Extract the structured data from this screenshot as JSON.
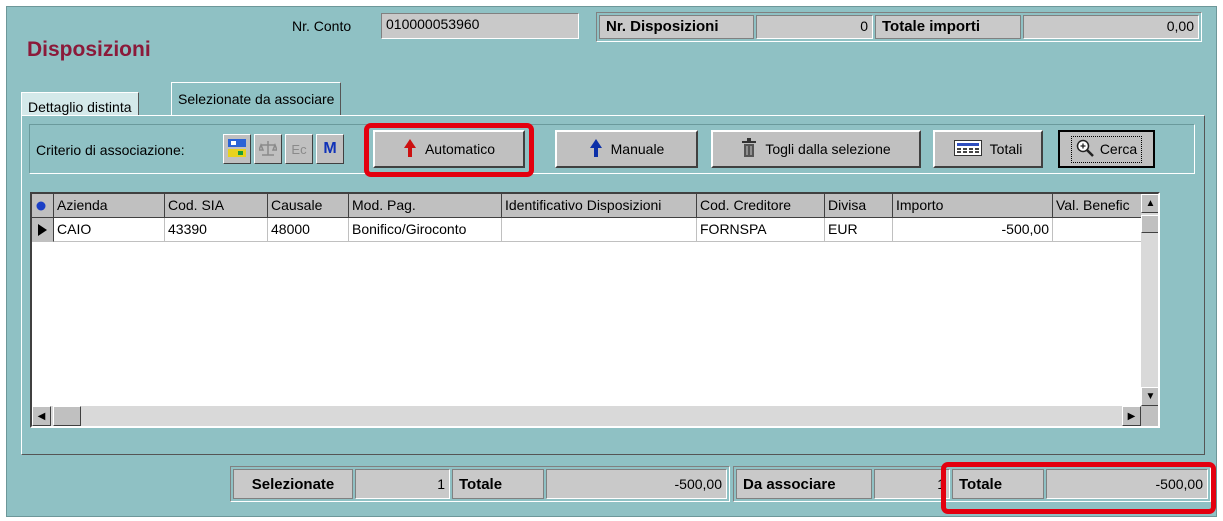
{
  "header": {
    "title": "Disposizioni",
    "account_label": "Nr. Conto",
    "account_value": "010000053960",
    "num_dispositions_label": "Nr. Disposizioni",
    "num_dispositions_value": "0",
    "total_amounts_label": "Totale importi",
    "total_amounts_value": "0,00"
  },
  "tabs": [
    {
      "label": "Dettaglio distinta",
      "active": false
    },
    {
      "label": "Selezionate da associare",
      "active": true
    }
  ],
  "toolbar": {
    "criterion_label": "Criterio di associazione:",
    "ec_label": "Ec",
    "m_label": "M",
    "automatic_label": "Automatico",
    "manual_label": "Manuale",
    "remove_label": "Togli dalla selezione",
    "totals_label": "Totali",
    "search_label": "Cerca"
  },
  "table": {
    "columns": [
      "Azienda",
      "Cod. SIA",
      "Causale",
      "Mod. Pag.",
      "Identificativo Disposizioni",
      "Cod. Creditore",
      "Divisa",
      "Importo",
      "Val. Benefic"
    ],
    "rows": [
      [
        "CAIO",
        "43390",
        "48000",
        "Bonifico/Giroconto",
        "",
        "FORNSPA",
        "EUR",
        "-500,00",
        ""
      ]
    ]
  },
  "footer": {
    "selected_label": "Selezionate",
    "selected_value": "1",
    "total_label": "Totale",
    "total_value": "-500,00",
    "to_associate_label": "Da associare",
    "to_associate_value": "1",
    "total2_label": "Totale",
    "total2_value": "-500,00"
  },
  "colors": {
    "background": "#8fc1c4",
    "title": "#8b1a3a",
    "highlight": "#e3000f",
    "automatic_arrow": "#cc1010",
    "manual_arrow": "#0b2fa8"
  },
  "icons": [
    "sort-indicator-icon",
    "ws-match-icon",
    "scale-icon",
    "arrow-up-red-icon",
    "arrow-up-blue-icon",
    "trash-icon",
    "calculator-icon",
    "magnifier-icon",
    "row-pointer-icon",
    "scroll-up-icon",
    "scroll-down-icon",
    "scroll-left-icon",
    "scroll-right-icon"
  ]
}
